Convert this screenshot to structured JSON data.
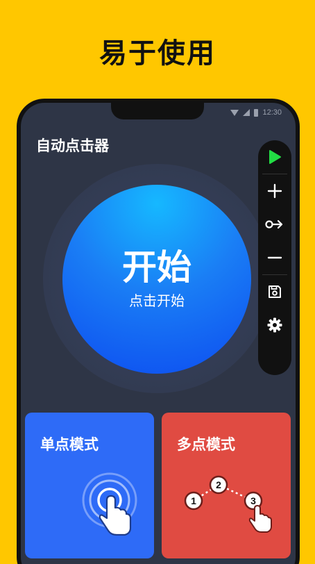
{
  "headline": "易于使用",
  "status_bar": {
    "time": "12:30"
  },
  "app": {
    "title": "自动点击器"
  },
  "start_button": {
    "label": "开始",
    "sublabel": "点击开始"
  },
  "toolbar": {
    "items": [
      {
        "icon": "play-icon"
      },
      {
        "icon": "plus-icon"
      },
      {
        "icon": "swipe-icon"
      },
      {
        "icon": "minus-icon"
      },
      {
        "icon": "save-icon"
      },
      {
        "icon": "gear-icon"
      }
    ]
  },
  "modes": {
    "single": {
      "label": "单点模式",
      "color": "#2E6BF7"
    },
    "multi": {
      "label": "多点模式",
      "color": "#E04B42",
      "points": [
        "1",
        "2",
        "3"
      ]
    }
  },
  "colors": {
    "background": "#FFC700",
    "accent_play": "#22DD44",
    "screen": "#2E3546"
  }
}
